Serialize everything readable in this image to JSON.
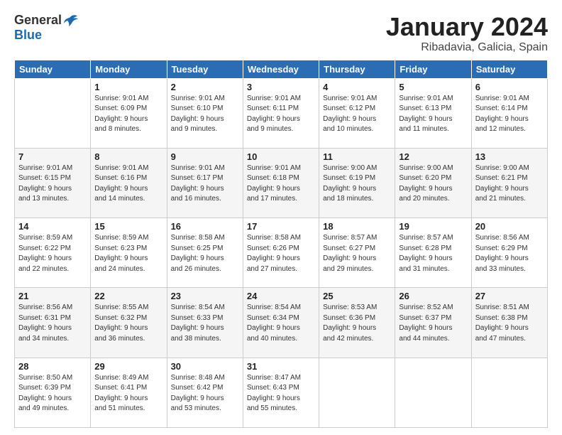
{
  "header": {
    "logo_general": "General",
    "logo_blue": "Blue",
    "title": "January 2024",
    "subtitle": "Ribadavia, Galicia, Spain"
  },
  "days_of_week": [
    "Sunday",
    "Monday",
    "Tuesday",
    "Wednesday",
    "Thursday",
    "Friday",
    "Saturday"
  ],
  "weeks": [
    [
      {
        "day": "",
        "info": ""
      },
      {
        "day": "1",
        "info": "Sunrise: 9:01 AM\nSunset: 6:09 PM\nDaylight: 9 hours\nand 8 minutes."
      },
      {
        "day": "2",
        "info": "Sunrise: 9:01 AM\nSunset: 6:10 PM\nDaylight: 9 hours\nand 9 minutes."
      },
      {
        "day": "3",
        "info": "Sunrise: 9:01 AM\nSunset: 6:11 PM\nDaylight: 9 hours\nand 9 minutes."
      },
      {
        "day": "4",
        "info": "Sunrise: 9:01 AM\nSunset: 6:12 PM\nDaylight: 9 hours\nand 10 minutes."
      },
      {
        "day": "5",
        "info": "Sunrise: 9:01 AM\nSunset: 6:13 PM\nDaylight: 9 hours\nand 11 minutes."
      },
      {
        "day": "6",
        "info": "Sunrise: 9:01 AM\nSunset: 6:14 PM\nDaylight: 9 hours\nand 12 minutes."
      }
    ],
    [
      {
        "day": "7",
        "info": "Sunrise: 9:01 AM\nSunset: 6:15 PM\nDaylight: 9 hours\nand 13 minutes."
      },
      {
        "day": "8",
        "info": "Sunrise: 9:01 AM\nSunset: 6:16 PM\nDaylight: 9 hours\nand 14 minutes."
      },
      {
        "day": "9",
        "info": "Sunrise: 9:01 AM\nSunset: 6:17 PM\nDaylight: 9 hours\nand 16 minutes."
      },
      {
        "day": "10",
        "info": "Sunrise: 9:01 AM\nSunset: 6:18 PM\nDaylight: 9 hours\nand 17 minutes."
      },
      {
        "day": "11",
        "info": "Sunrise: 9:00 AM\nSunset: 6:19 PM\nDaylight: 9 hours\nand 18 minutes."
      },
      {
        "day": "12",
        "info": "Sunrise: 9:00 AM\nSunset: 6:20 PM\nDaylight: 9 hours\nand 20 minutes."
      },
      {
        "day": "13",
        "info": "Sunrise: 9:00 AM\nSunset: 6:21 PM\nDaylight: 9 hours\nand 21 minutes."
      }
    ],
    [
      {
        "day": "14",
        "info": "Sunrise: 8:59 AM\nSunset: 6:22 PM\nDaylight: 9 hours\nand 22 minutes."
      },
      {
        "day": "15",
        "info": "Sunrise: 8:59 AM\nSunset: 6:23 PM\nDaylight: 9 hours\nand 24 minutes."
      },
      {
        "day": "16",
        "info": "Sunrise: 8:58 AM\nSunset: 6:25 PM\nDaylight: 9 hours\nand 26 minutes."
      },
      {
        "day": "17",
        "info": "Sunrise: 8:58 AM\nSunset: 6:26 PM\nDaylight: 9 hours\nand 27 minutes."
      },
      {
        "day": "18",
        "info": "Sunrise: 8:57 AM\nSunset: 6:27 PM\nDaylight: 9 hours\nand 29 minutes."
      },
      {
        "day": "19",
        "info": "Sunrise: 8:57 AM\nSunset: 6:28 PM\nDaylight: 9 hours\nand 31 minutes."
      },
      {
        "day": "20",
        "info": "Sunrise: 8:56 AM\nSunset: 6:29 PM\nDaylight: 9 hours\nand 33 minutes."
      }
    ],
    [
      {
        "day": "21",
        "info": "Sunrise: 8:56 AM\nSunset: 6:31 PM\nDaylight: 9 hours\nand 34 minutes."
      },
      {
        "day": "22",
        "info": "Sunrise: 8:55 AM\nSunset: 6:32 PM\nDaylight: 9 hours\nand 36 minutes."
      },
      {
        "day": "23",
        "info": "Sunrise: 8:54 AM\nSunset: 6:33 PM\nDaylight: 9 hours\nand 38 minutes."
      },
      {
        "day": "24",
        "info": "Sunrise: 8:54 AM\nSunset: 6:34 PM\nDaylight: 9 hours\nand 40 minutes."
      },
      {
        "day": "25",
        "info": "Sunrise: 8:53 AM\nSunset: 6:36 PM\nDaylight: 9 hours\nand 42 minutes."
      },
      {
        "day": "26",
        "info": "Sunrise: 8:52 AM\nSunset: 6:37 PM\nDaylight: 9 hours\nand 44 minutes."
      },
      {
        "day": "27",
        "info": "Sunrise: 8:51 AM\nSunset: 6:38 PM\nDaylight: 9 hours\nand 47 minutes."
      }
    ],
    [
      {
        "day": "28",
        "info": "Sunrise: 8:50 AM\nSunset: 6:39 PM\nDaylight: 9 hours\nand 49 minutes."
      },
      {
        "day": "29",
        "info": "Sunrise: 8:49 AM\nSunset: 6:41 PM\nDaylight: 9 hours\nand 51 minutes."
      },
      {
        "day": "30",
        "info": "Sunrise: 8:48 AM\nSunset: 6:42 PM\nDaylight: 9 hours\nand 53 minutes."
      },
      {
        "day": "31",
        "info": "Sunrise: 8:47 AM\nSunset: 6:43 PM\nDaylight: 9 hours\nand 55 minutes."
      },
      {
        "day": "",
        "info": ""
      },
      {
        "day": "",
        "info": ""
      },
      {
        "day": "",
        "info": ""
      }
    ]
  ]
}
